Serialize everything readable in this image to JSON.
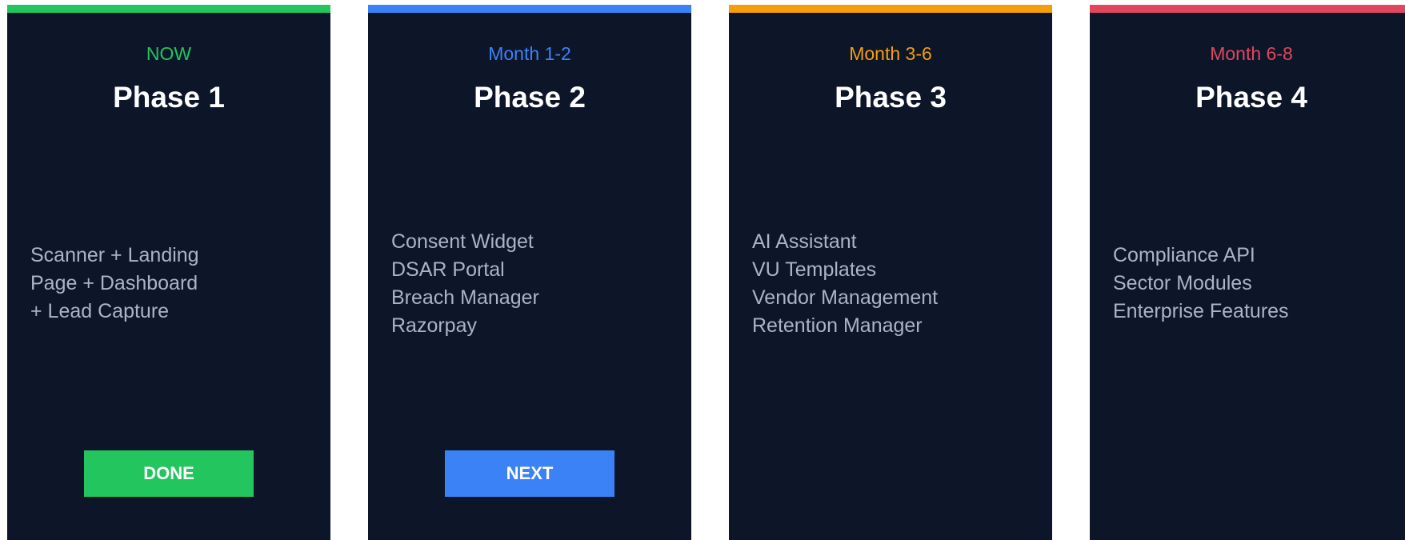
{
  "phases": [
    {
      "timeframe": "NOW",
      "title": "Phase 1",
      "color": "#22c55e",
      "features": [
        "Scanner + Landing",
        "Page + Dashboard",
        "+ Lead Capture"
      ],
      "button_label": "DONE"
    },
    {
      "timeframe": "Month 1-2",
      "title": "Phase 2",
      "color": "#3b82f6",
      "features": [
        "Consent Widget",
        "DSAR Portal",
        "Breach Manager",
        "Razorpay"
      ],
      "button_label": "NEXT"
    },
    {
      "timeframe": "Month 3-6",
      "title": "Phase 3",
      "color": "#f59e0b",
      "features": [
        "AI Assistant",
        "VU Templates",
        "Vendor Management",
        "Retention Manager"
      ]
    },
    {
      "timeframe": "Month 6-8",
      "title": "Phase 4",
      "color": "#e0465e",
      "features": [
        "Compliance API",
        "Sector Modules",
        "Enterprise Features"
      ]
    }
  ]
}
